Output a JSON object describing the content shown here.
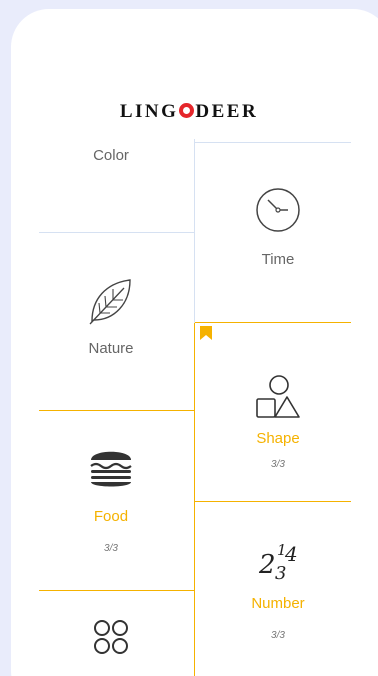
{
  "app": {
    "logo_left": "LING",
    "logo_right": "DEER"
  },
  "colors": {
    "gold": "#f5b200",
    "divider": "#d6e1f2",
    "background": "#e9ecfb",
    "logo_red": "#e5262b"
  },
  "categories": [
    {
      "label": "Color",
      "progress": "",
      "icon": "color-icon",
      "state": "locked"
    },
    {
      "label": "Time",
      "progress": "",
      "icon": "clock-icon",
      "state": "locked"
    },
    {
      "label": "Nature",
      "progress": "",
      "icon": "leaf-icon",
      "state": "locked"
    },
    {
      "label": "Shape",
      "progress": "3/3",
      "icon": "shapes-icon",
      "state": "completed",
      "bookmarked": true
    },
    {
      "label": "Food",
      "progress": "3/3",
      "icon": "burger-icon",
      "state": "completed"
    },
    {
      "label": "Number",
      "progress": "3/3",
      "icon": "numbers-icon",
      "state": "completed"
    },
    {
      "label": "",
      "progress": "",
      "icon": "circles-icon",
      "state": "completed"
    }
  ]
}
